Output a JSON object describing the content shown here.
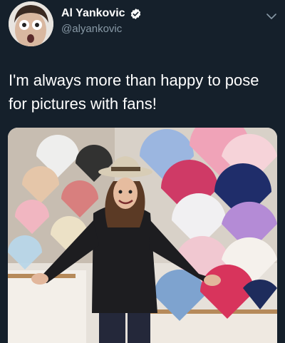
{
  "user": {
    "display_name": "Al Yankovic",
    "handle": "@alyankovic",
    "verified_icon": "verified-badge-icon",
    "avatar_icon": "profile-avatar"
  },
  "menu": {
    "icon": "chevron-down-icon"
  },
  "tweet": {
    "text": "I'm always more than happy to pose for pictures with fans!"
  },
  "media": {
    "subject": "photo-of-man-with-display-of-folding-fans"
  },
  "colors": {
    "background": "#15202b",
    "text_primary": "#ffffff",
    "text_secondary": "#8899a6",
    "verified": "#ffffff"
  }
}
